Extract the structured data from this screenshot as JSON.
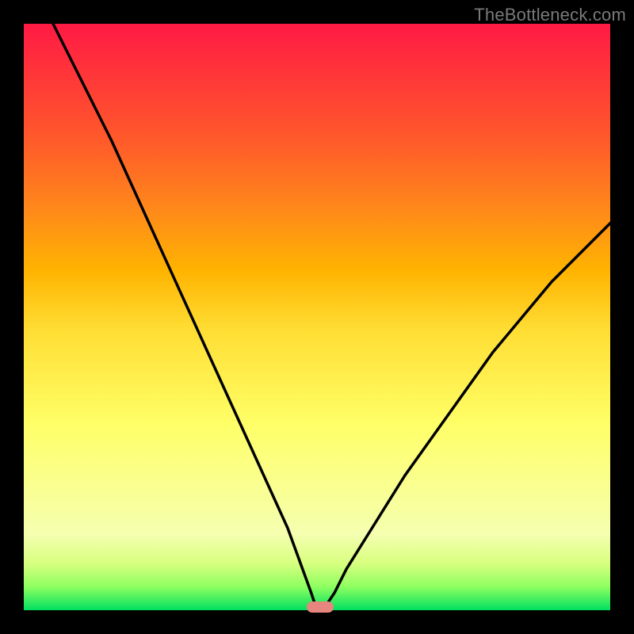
{
  "watermark": "TheBottleneck.com",
  "chart_data": {
    "type": "line",
    "title": "",
    "xlabel": "",
    "ylabel": "",
    "xlim": [
      0,
      100
    ],
    "ylim": [
      0,
      100
    ],
    "grid": false,
    "series": [
      {
        "name": "bottleneck-curve",
        "x": [
          5,
          10,
          15,
          20,
          25,
          30,
          35,
          40,
          45,
          49,
          50,
          51,
          53,
          55,
          60,
          65,
          70,
          75,
          80,
          85,
          90,
          95,
          100
        ],
        "values": [
          100,
          90,
          80,
          69,
          58,
          47,
          36,
          25,
          14,
          3,
          0,
          0,
          3,
          7,
          15,
          23,
          30,
          37,
          44,
          50,
          56,
          61,
          66
        ]
      }
    ],
    "annotations": [
      {
        "name": "optimal-marker",
        "x": 50.5,
        "y": 0.5
      }
    ],
    "background_gradient": {
      "direction": "vertical-bottom-to-top",
      "stops": [
        {
          "pos": 0.0,
          "color": "#00e060"
        },
        {
          "pos": 0.04,
          "color": "#8eff60"
        },
        {
          "pos": 0.08,
          "color": "#d8ff80"
        },
        {
          "pos": 0.13,
          "color": "#f5ffb0"
        },
        {
          "pos": 0.32,
          "color": "#ffff66"
        },
        {
          "pos": 0.48,
          "color": "#ffdd33"
        },
        {
          "pos": 0.58,
          "color": "#ffb300"
        },
        {
          "pos": 0.68,
          "color": "#ff8a1a"
        },
        {
          "pos": 0.8,
          "color": "#ff5a2a"
        },
        {
          "pos": 1.0,
          "color": "#ff1a44"
        }
      ]
    }
  }
}
